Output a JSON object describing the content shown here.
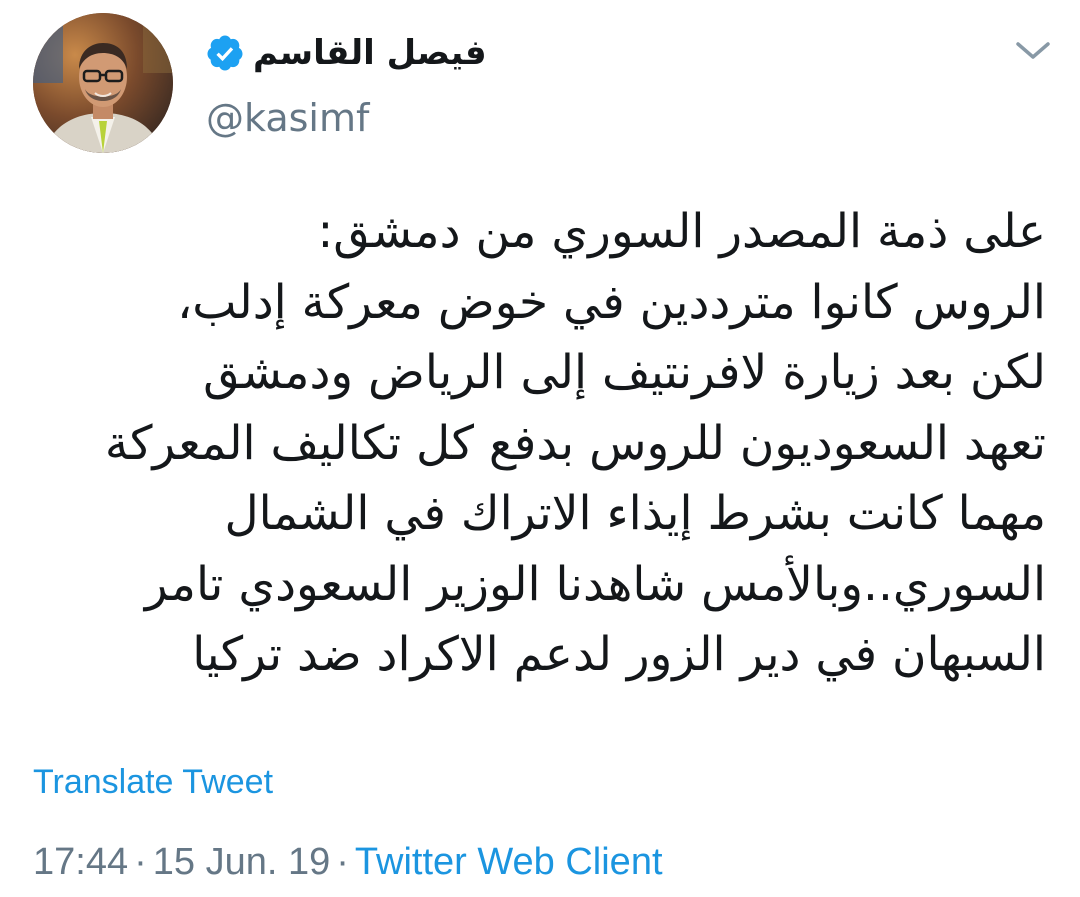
{
  "author": {
    "display_name": "فيصل القاسم",
    "handle": "@kasimf",
    "verified": true,
    "avatar_icon": "profile-photo"
  },
  "tweet": {
    "lines": [
      "على ذمة المصدر السوري من دمشق:",
      "الروس كانوا مترددين في خوض معركة إدلب،",
      "لكن بعد زيارة لافرنتيف إلى الرياض ودمشق",
      "تعهد السعوديون للروس بدفع كل تكاليف المعركة",
      "مهما كانت بشرط إيذاء الاتراك في الشمال",
      "السوري..وبالأمس شاهدنا الوزير السعودي تامر",
      "السبهان في دير الزور لدعم الاكراد ضد تركيا"
    ]
  },
  "actions": {
    "translate_label": "Translate Tweet",
    "menu_icon": "chevron-down-icon"
  },
  "meta": {
    "time": "17:44",
    "separator": "·",
    "date": "15 Jun. 19",
    "source": "Twitter Web Client"
  },
  "colors": {
    "link": "#1b95e0",
    "secondary_text": "#657786",
    "primary_text": "#14171a",
    "verified": "#1da1f2"
  }
}
